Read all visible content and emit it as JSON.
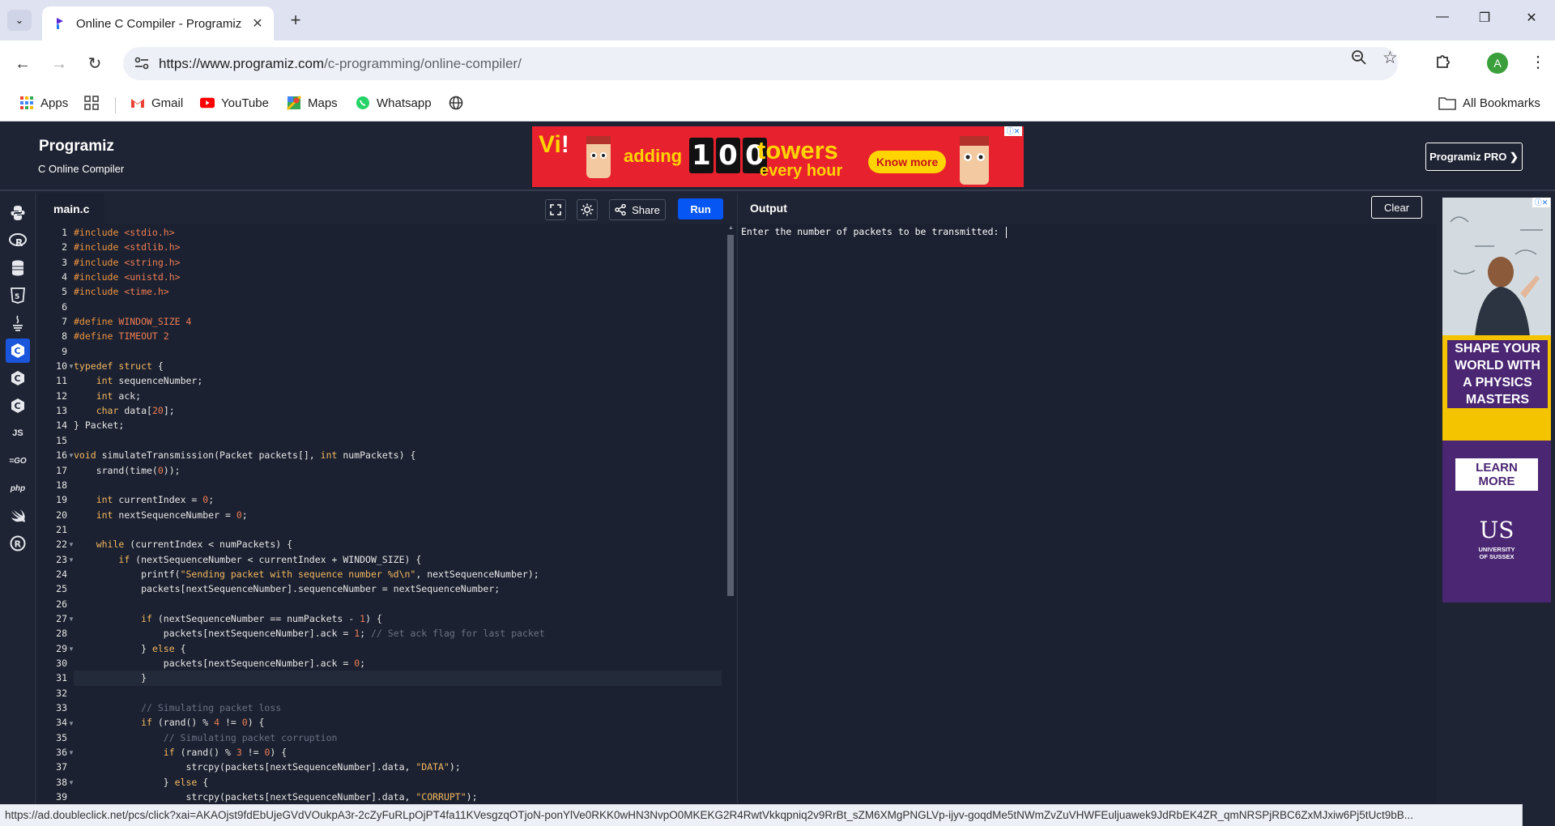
{
  "browser": {
    "tab_title": "Online C Compiler - Programiz",
    "url_host": "https://www.programiz.com",
    "url_path": "/c-programming/online-compiler/",
    "avatar_letter": "A",
    "bookmarks": [
      "Apps",
      "Gmail",
      "YouTube",
      "Maps",
      "Whatsapp"
    ],
    "all_bookmarks_label": "All Bookmarks"
  },
  "site": {
    "logo": "Programiz",
    "subtitle": "C Online Compiler",
    "pro_button": "Programiz PRO ❯"
  },
  "top_ad": {
    "brand": "Vi",
    "text_adding": "adding",
    "counter": [
      "1",
      "0",
      "0"
    ],
    "text_towers": "towers",
    "text_hour": "every hour",
    "cta": "Know more"
  },
  "languages": [
    "python",
    "r",
    "sql",
    "html",
    "java",
    "c",
    "c++",
    "c#",
    "js",
    "go",
    "php",
    "swift",
    "rust"
  ],
  "editor": {
    "file_name": "main.c",
    "share_label": "Share",
    "run_label": "Run",
    "current_line": 31,
    "line_numbers": [
      "1",
      "2",
      "3",
      "4",
      "5",
      "6",
      "7",
      "8",
      "9",
      "10",
      "11",
      "12",
      "13",
      "14",
      "15",
      "16",
      "17",
      "18",
      "19",
      "20",
      "21",
      "22",
      "23",
      "24",
      "25",
      "26",
      "27",
      "28",
      "29",
      "30",
      "31",
      "32",
      "33",
      "34",
      "35",
      "36",
      "37",
      "38",
      "39"
    ],
    "lines": [
      "#include <stdio.h>",
      "#include <stdlib.h>",
      "#include <string.h>",
      "#include <unistd.h>",
      "#include <time.h>",
      "",
      "#define WINDOW_SIZE 4",
      "#define TIMEOUT 2",
      "",
      "typedef struct {",
      "    int sequenceNumber;",
      "    int ack;",
      "    char data[20];",
      "} Packet;",
      "",
      "void simulateTransmission(Packet packets[], int numPackets) {",
      "    srand(time(0));",
      "",
      "    int currentIndex = 0;",
      "    int nextSequenceNumber = 0;",
      "",
      "    while (currentIndex < numPackets) {",
      "        if (nextSequenceNumber < currentIndex + WINDOW_SIZE) {",
      "            printf(\"Sending packet with sequence number %d\\n\", nextSequenceNumber);",
      "            packets[nextSequenceNumber].sequenceNumber = nextSequenceNumber;",
      "",
      "            if (nextSequenceNumber == numPackets - 1) {",
      "                packets[nextSequenceNumber].ack = 1; // Set ack flag for last packet",
      "            } else {",
      "                packets[nextSequenceNumber].ack = 0;",
      "            }",
      "",
      "            // Simulating packet loss",
      "            if (rand() % 4 != 0) {",
      "                // Simulating packet corruption",
      "                if (rand() % 3 != 0) {",
      "                    strcpy(packets[nextSequenceNumber].data, \"DATA\");",
      "                } else {",
      "                    strcpy(packets[nextSequenceNumber].data, \"CORRUPT\");"
    ]
  },
  "output": {
    "title": "Output",
    "clear_label": "Clear",
    "text": "Enter the number of packets to be transmitted: "
  },
  "side_ad": {
    "headline_lines": [
      "SHAPE YOUR",
      "WORLD WITH",
      "A PHYSICS",
      "MASTERS"
    ],
    "cta_lines": [
      "LEARN",
      "MORE"
    ],
    "logo": "US",
    "logo_sub_lines": [
      "UNIVERSITY",
      "OF SUSSEX"
    ]
  },
  "status_url": "https://ad.doubleclick.net/pcs/click?xai=AKAOjst9fdEbUjeGVdVOukpA3r-2cZyFuRLpOjPT4fa11KVesgzqOTjoN-ponYlVe0RKK0wHN3NvpO0MKEKG2R4RwtVkkqpniq2v9RrBt_sZM6XMgPNGLVp-ijyv-goqdMe5tNWmZvZuVHWFEuljuawek9JdRbEK4ZR_qmNRSPjRBC6ZxMJxiw6Pj5tUct9bB..."
}
